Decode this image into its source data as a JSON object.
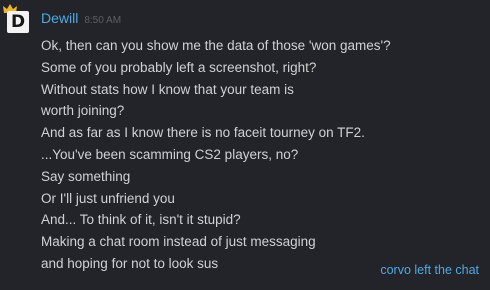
{
  "message": {
    "username": "Dewill",
    "timestamp": "8:50 AM",
    "avatar_letter": "D",
    "lines": [
      "Ok, then can you show me the data of those 'won games'?",
      "Some of you probably left a screenshot, right?",
      "Without stats how I know that your team is",
      "worth joining?",
      "And as far as I know there is no faceit tourney on TF2.",
      "...You've been scamming CS2 players, no?",
      "Say something",
      "Or I'll just unfriend you",
      "And... To think of it, isn't it stupid?",
      "Making a chat room instead of just messaging",
      "and hoping for not to look sus"
    ]
  },
  "system_notice": "corvo left the chat",
  "colors": {
    "background": "#222429",
    "username": "#4fa9e3",
    "message_text": "#d0d2d5",
    "timestamp": "#5b5f66",
    "crown": "#e9b52c"
  },
  "icons": {
    "crown": "crown-icon"
  }
}
